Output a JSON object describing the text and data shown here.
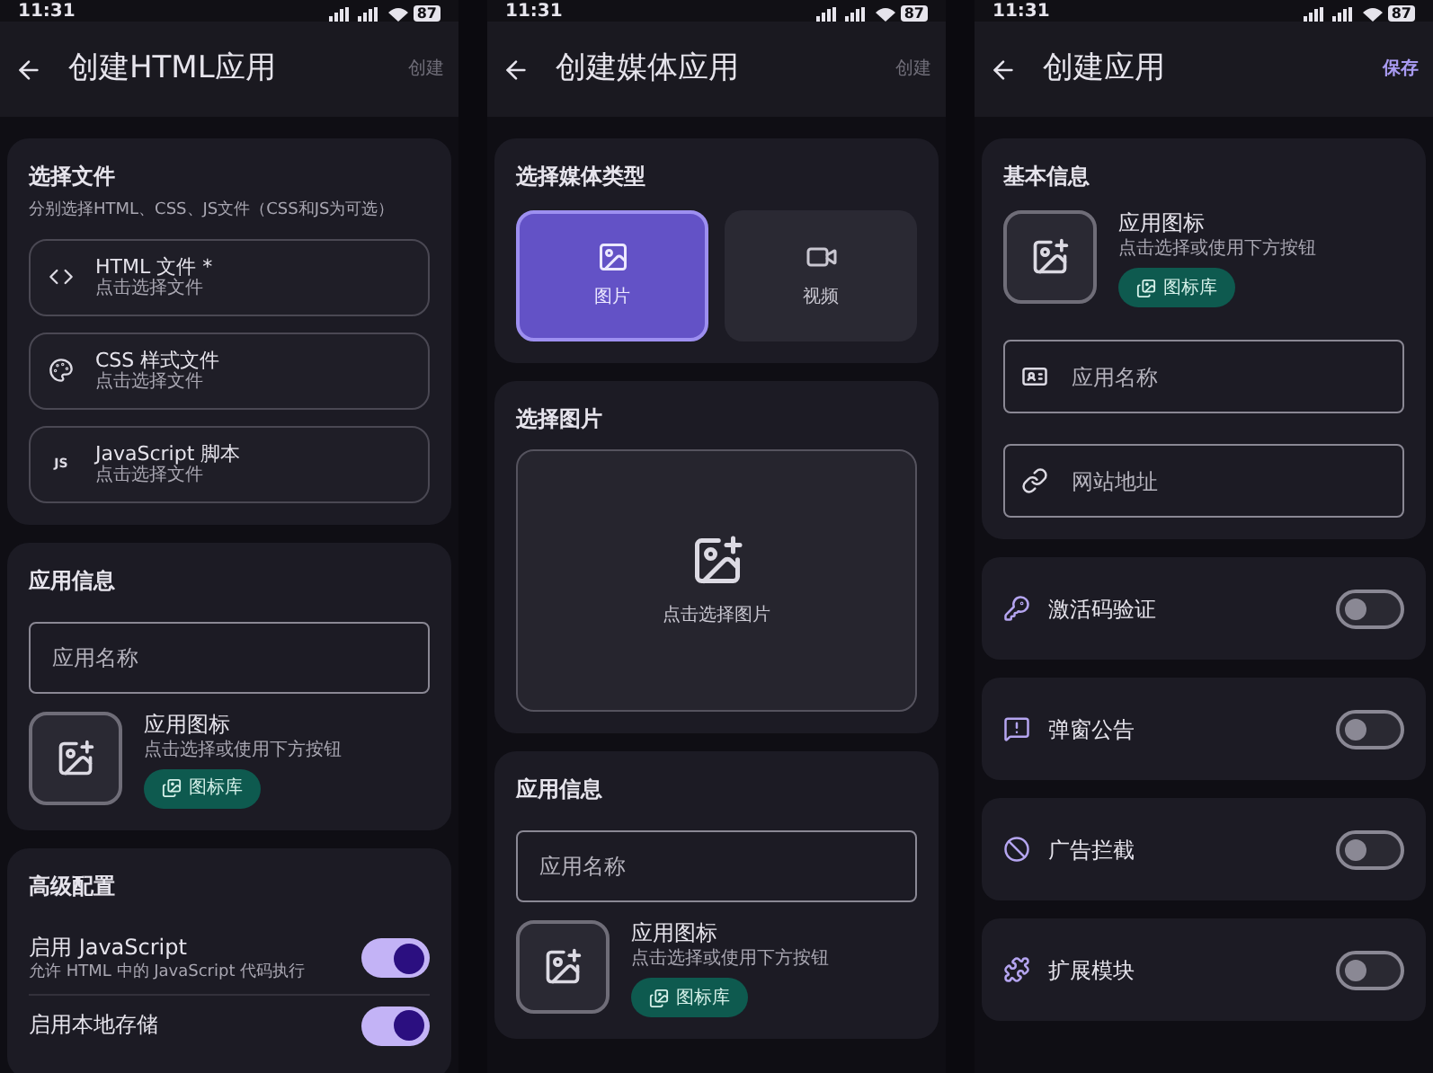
{
  "screens": [
    {
      "status": {
        "time": "11:31",
        "battery": "87"
      },
      "app_bar": {
        "title": "创建HTML应用",
        "action": "创建",
        "action_enabled": false
      },
      "sections": [
        {
          "kind": "files",
          "title": "选择文件",
          "subtitle": "分别选择HTML、CSS、JS文件（CSS和JS为可选）",
          "items": [
            {
              "label": "HTML 文件 *",
              "hint": "点击选择文件"
            },
            {
              "label": "CSS 样式文件",
              "hint": "点击选择文件"
            },
            {
              "label": "JavaScript 脚本",
              "hint": "点击选择文件",
              "icon_text": "JS"
            }
          ]
        },
        {
          "kind": "app_info",
          "title": "应用信息",
          "name_placeholder": "应用名称",
          "icon_label": "应用图标",
          "icon_hint": "点击选择或使用下方按钮",
          "library_button": "图标库"
        },
        {
          "kind": "advanced",
          "title": "高级配置",
          "toggles": [
            {
              "label": "启用 JavaScript",
              "description": "允许 HTML 中的 JavaScript 代码执行",
              "on": true
            },
            {
              "label": "启用本地存储",
              "on": true
            }
          ]
        }
      ]
    },
    {
      "status": {
        "time": "11:31",
        "battery": "87"
      },
      "app_bar": {
        "title": "创建媒体应用",
        "action": "创建",
        "action_enabled": false
      },
      "sections": [
        {
          "kind": "media_type",
          "title": "选择媒体类型",
          "options": [
            {
              "label": "图片",
              "selected": true
            },
            {
              "label": "视频",
              "selected": false
            }
          ]
        },
        {
          "kind": "image_picker",
          "title": "选择图片",
          "hint": "点击选择图片"
        },
        {
          "kind": "app_info",
          "title": "应用信息",
          "name_placeholder": "应用名称",
          "icon_label": "应用图标",
          "icon_hint": "点击选择或使用下方按钮",
          "library_button": "图标库"
        }
      ]
    },
    {
      "status": {
        "time": "11:31",
        "battery": "87"
      },
      "app_bar": {
        "title": "创建应用",
        "action": "保存",
        "action_enabled": true
      },
      "sections": [
        {
          "kind": "basic_info",
          "title": "基本信息",
          "icon_label": "应用图标",
          "icon_hint": "点击选择或使用下方按钮",
          "library_button": "图标库",
          "fields": [
            {
              "placeholder": "应用名称"
            },
            {
              "placeholder": "网站地址"
            }
          ]
        },
        {
          "kind": "toggle_card",
          "label": "激活码验证",
          "on": false
        },
        {
          "kind": "toggle_card",
          "label": "弹窗公告",
          "on": false
        },
        {
          "kind": "toggle_card",
          "label": "广告拦截",
          "on": false
        },
        {
          "kind": "toggle_card",
          "label": "扩展模块",
          "on": false
        }
      ]
    }
  ]
}
